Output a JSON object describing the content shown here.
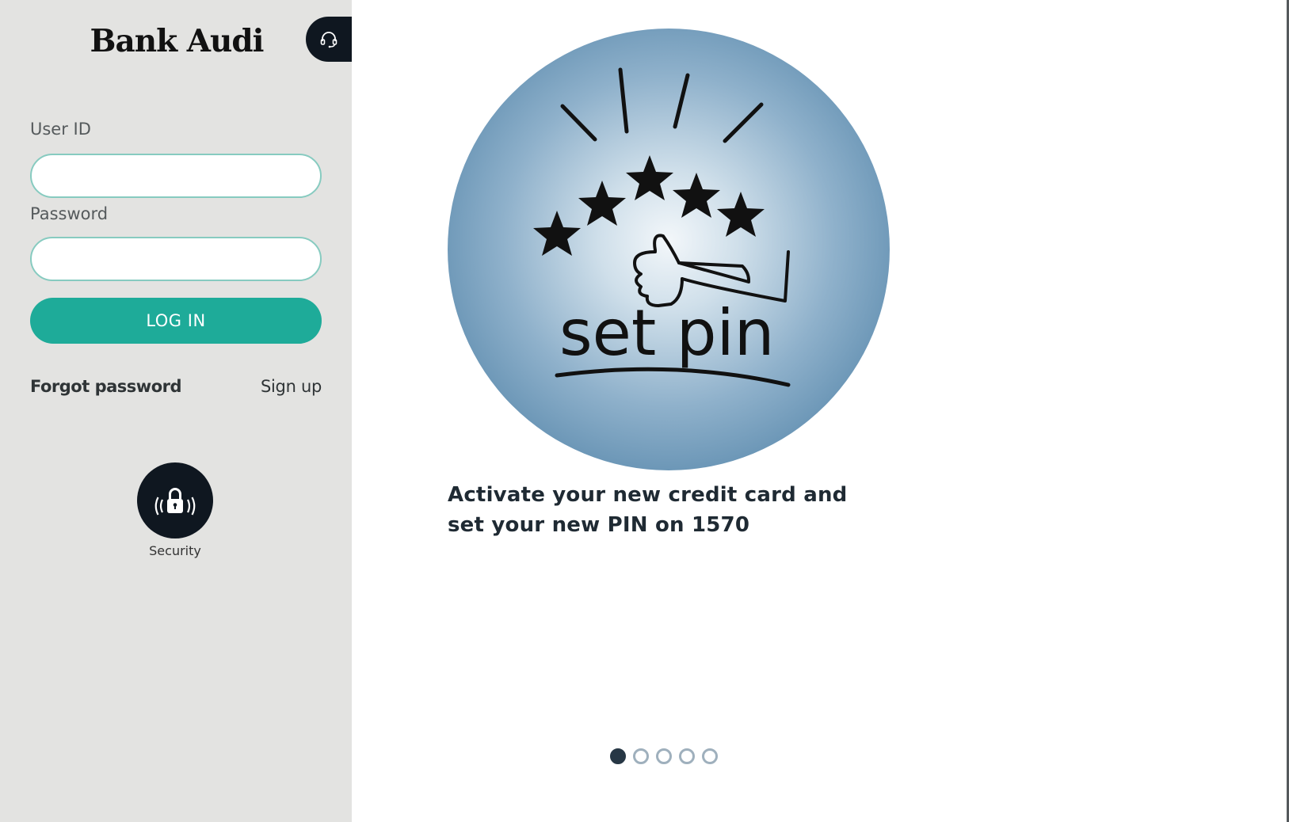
{
  "brand": {
    "logo_text": "Bank Audi"
  },
  "sidebar": {
    "support_icon": "headset-icon",
    "user_id_label": "User ID",
    "user_id_value": "",
    "password_label": "Password",
    "password_value": "",
    "login_label": "LOG IN",
    "forgot_password_label": "Forgot password",
    "sign_up_label": "Sign up",
    "security_icon": "lock-signal-icon",
    "security_label": "Security"
  },
  "carousel": {
    "image_text": "set pin",
    "caption": "Activate your new credit card and set your new PIN on 1570",
    "slide_count": 5,
    "active_slide": 1
  },
  "colors": {
    "sidebar_bg": "#e3e3e1",
    "accent": "#1eab99",
    "input_border": "#87cbc0",
    "dark": "#0f1720"
  }
}
